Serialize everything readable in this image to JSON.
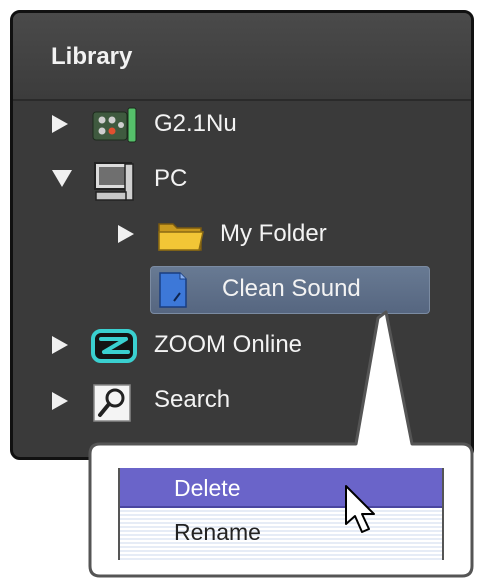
{
  "library": {
    "title": "Library",
    "items": [
      {
        "label": "G2.1Nu",
        "icon": "device-icon",
        "expanded": false
      },
      {
        "label": "PC",
        "icon": "computer-icon",
        "expanded": true
      },
      {
        "label": "My Folder",
        "icon": "folder-icon",
        "expanded": false
      },
      {
        "label": "Clean Sound",
        "icon": "patch-icon",
        "selected": true
      },
      {
        "label": "ZOOM Online",
        "icon": "zoom-logo-icon",
        "expanded": false
      },
      {
        "label": "Search",
        "icon": "magnifier-icon",
        "expanded": false
      }
    ]
  },
  "context_menu": {
    "items": [
      {
        "label": "Delete",
        "highlighted": true
      },
      {
        "label": "Rename",
        "highlighted": false
      }
    ]
  },
  "colors": {
    "panel_bg": "#3a3a3a",
    "selection": "#5f708b",
    "menu_highlight": "#6a64c9"
  }
}
